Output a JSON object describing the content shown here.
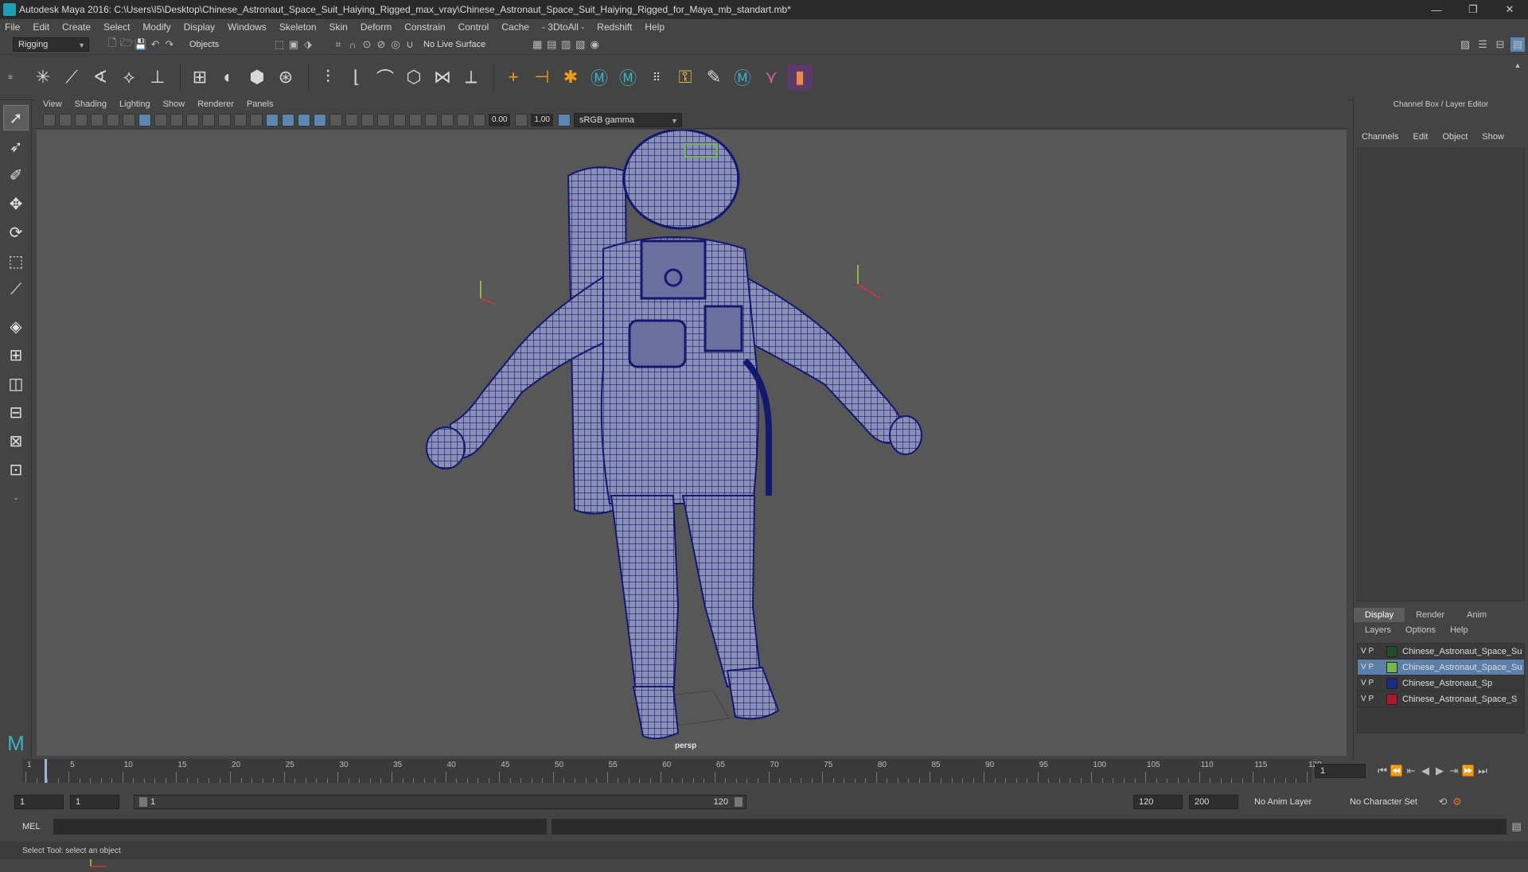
{
  "window": {
    "title": "Autodesk Maya 2016: C:\\Users\\I5\\Desktop\\Chinese_Astronaut_Space_Suit_Haiying_Rigged_max_vray\\Chinese_Astronaut_Space_Suit_Haiying_Rigged_for_Maya_mb_standart.mb*",
    "minimize": "—",
    "maximize": "❐",
    "close": "✕"
  },
  "menus": [
    "File",
    "Edit",
    "Create",
    "Select",
    "Modify",
    "Display",
    "Windows",
    "Skeleton",
    "Skin",
    "Deform",
    "Constrain",
    "Control",
    "Cache",
    "- 3DtoAll -",
    "Redshift",
    "Help"
  ],
  "statusline": {
    "mode": "Rigging",
    "selection_mode": "Objects",
    "live_surface": "No Live Surface"
  },
  "viewport": {
    "menus": [
      "View",
      "Shading",
      "Lighting",
      "Show",
      "Renderer",
      "Panels"
    ],
    "near_value": "0.00",
    "far_value": "1.00",
    "color_space": "sRGB gamma",
    "camera": "persp"
  },
  "channel_box": {
    "title": "Channel Box / Layer Editor",
    "tabs": [
      "Channels",
      "Edit",
      "Object",
      "Show"
    ],
    "display_tabs": [
      "Display",
      "Render",
      "Anim"
    ],
    "layer_menus": [
      "Layers",
      "Options",
      "Help"
    ],
    "layers": [
      {
        "v": "V",
        "p": "P",
        "name": "Chinese_Astronaut_Space_Su",
        "color": "#1f4d2a",
        "selected": false
      },
      {
        "v": "V",
        "p": "P",
        "name": "Chinese_Astronaut_Space_Su",
        "color": "#77b84a",
        "selected": true
      },
      {
        "v": "V",
        "p": "P",
        "name": "Chinese_Astronaut_Sp",
        "color": "#1a2b8c",
        "selected": false
      },
      {
        "v": "V",
        "p": "P",
        "name": "Chinese_Astronaut_Space_S",
        "color": "#b0162a",
        "selected": false
      }
    ]
  },
  "timeline": {
    "labels": [
      "1",
      "5",
      "10",
      "15",
      "20",
      "25",
      "30",
      "35",
      "40",
      "45",
      "50",
      "55",
      "60",
      "65",
      "70",
      "75",
      "80",
      "85",
      "90",
      "95",
      "100",
      "105",
      "110",
      "115",
      "120"
    ],
    "current_frame": "1"
  },
  "range": {
    "start": "1",
    "playback_start": "1",
    "slider_start": "1",
    "slider_end": "120",
    "playback_end": "120",
    "end": "200",
    "anim_layer": "No Anim Layer",
    "character_set": "No Character Set"
  },
  "command_line": {
    "label": "MEL"
  },
  "help_line": "Select Tool: select an object"
}
